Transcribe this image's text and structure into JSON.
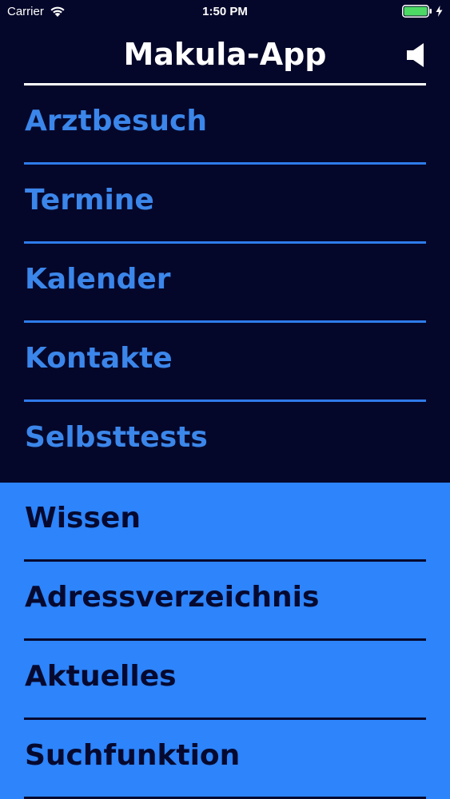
{
  "status_bar": {
    "carrier": "Carrier",
    "time": "1:50 PM",
    "battery_color": "#4cd964"
  },
  "header": {
    "title": "Makula-App"
  },
  "colors": {
    "background_dark": "#05072a",
    "accent_blue": "#2d84fb",
    "text_dark": "#06092f"
  },
  "menu_primary": [
    {
      "label": "Arztbesuch"
    },
    {
      "label": "Termine"
    },
    {
      "label": "Kalender"
    },
    {
      "label": "Kontakte"
    },
    {
      "label": "Selbsttests"
    }
  ],
  "menu_secondary": [
    {
      "label": "Wissen"
    },
    {
      "label": "Adressverzeichnis"
    },
    {
      "label": "Aktuelles"
    },
    {
      "label": "Suchfunktion"
    }
  ]
}
